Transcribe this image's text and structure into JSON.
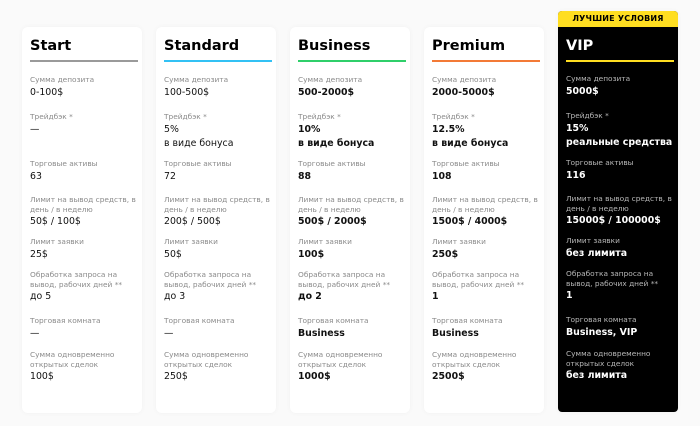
{
  "badge": "ЛУЧШИЕ УСЛОВИЯ",
  "labels": {
    "deposit": "Сумма депозита",
    "tradeback": "Трейдбэк *",
    "assets": "Торговые активы",
    "withdraw": "Лимит на вывод средств, в день / в неделю",
    "order": "Лимит заявки",
    "processing": "Обработка запроса на вывод, рабочих дней **",
    "room": "Торговая комната",
    "open": "Сумма одновременно открытых сделок"
  },
  "plans": [
    {
      "name": "Start",
      "accent": "#9a9a9a",
      "deposit": "0-100$",
      "tradeback": "—",
      "tradeback_note": "",
      "assets": "63",
      "withdraw": "50$ / 100$",
      "order": "25$",
      "processing": "до 5",
      "room": "—",
      "open": "100$"
    },
    {
      "name": "Standard",
      "accent": "#33c1f4",
      "deposit": "100-500$",
      "tradeback": "5%",
      "tradeback_note": "в виде бонуса",
      "assets": "72",
      "withdraw": "200$ / 500$",
      "order": "50$",
      "processing": "до 3",
      "room": "—",
      "open": "250$"
    },
    {
      "name": "Business",
      "accent": "#2fcf6a",
      "deposit": "500-2000$",
      "tradeback": "10%",
      "tradeback_note": "в виде бонуса",
      "assets": "88",
      "withdraw": "500$ / 2000$",
      "order": "100$",
      "processing": "до 2",
      "room": "Business",
      "open": "1000$"
    },
    {
      "name": "Premium",
      "accent": "#f37a36",
      "deposit": "2000-5000$",
      "tradeback": "12.5%",
      "tradeback_note": "в виде бонуса",
      "assets": "108",
      "withdraw": "1500$ / 4000$",
      "order": "250$",
      "processing": "1",
      "room": "Business",
      "open": "2500$"
    },
    {
      "name": "VIP",
      "accent": "#ffde21",
      "deposit": "5000$",
      "tradeback": "15%",
      "tradeback_note": "реальные средства",
      "assets": "116",
      "withdraw": "15000$ / 100000$",
      "order": "без лимита",
      "processing": "1",
      "room": "Business, VIP",
      "open": "без лимита"
    }
  ]
}
